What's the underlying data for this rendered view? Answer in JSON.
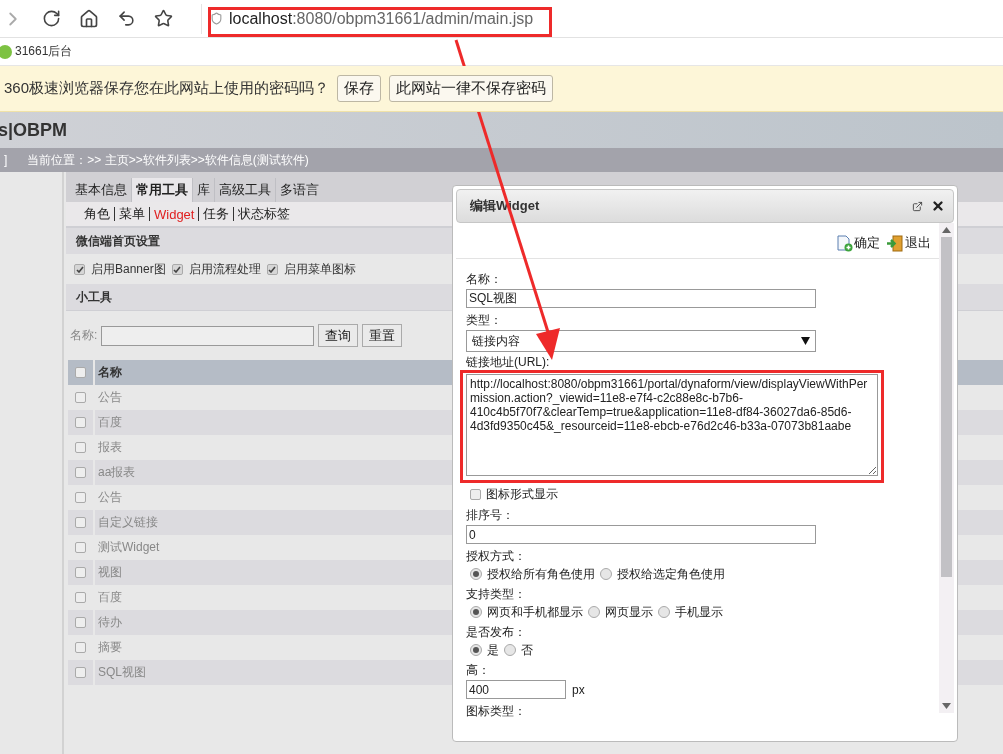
{
  "browser": {
    "address": {
      "host": "localhost",
      "rest": ":8080/obpm31661/admin/main.jsp"
    },
    "bookmark": "31661后台"
  },
  "password_prompt": {
    "message": "360极速浏览器保存您在此网站上使用的密码吗？",
    "buttons": [
      "保存",
      "此网站一律不保存密码"
    ]
  },
  "header": {
    "logo": "s|OBPM"
  },
  "breadcrumb": {
    "edit_link": "]",
    "location": "当前位置：>> 主页>>软件列表>>软件信息(测试软件)"
  },
  "tabs": [
    {
      "label": "基本信息",
      "selected": false
    },
    {
      "label": "常用工具",
      "selected": true
    },
    {
      "label": "库",
      "selected": false
    },
    {
      "label": "高级工具",
      "selected": false
    },
    {
      "label": "多语言",
      "selected": false
    }
  ],
  "subtabs": [
    {
      "label": "角色",
      "selected": false
    },
    {
      "label": "菜单",
      "selected": false
    },
    {
      "label": "Widget",
      "selected": true
    },
    {
      "label": "任务",
      "selected": false
    },
    {
      "label": "状态标签",
      "selected": false
    }
  ],
  "wechat_section": {
    "title": "微信端首页设置",
    "options": [
      {
        "label": "启用Banner图",
        "checked": true
      },
      {
        "label": "启用流程处理",
        "checked": true
      },
      {
        "label": "启用菜单图标",
        "checked": true
      }
    ]
  },
  "widgets_section": {
    "title": "小工具",
    "search_label": "名称:",
    "buttons": [
      "查询",
      "重置"
    ],
    "table": {
      "columns": [
        "名称"
      ],
      "select_all_checked": false,
      "rows": [
        {
          "name": "公告",
          "checked": false
        },
        {
          "name": "百度",
          "checked": false
        },
        {
          "name": "报表",
          "checked": false
        },
        {
          "name": "aa报表",
          "checked": false
        },
        {
          "name": "公告",
          "checked": false
        },
        {
          "name": "自定义链接",
          "checked": false
        },
        {
          "name": "测试Widget",
          "checked": false
        },
        {
          "name": "视图",
          "checked": false
        },
        {
          "name": "百度",
          "checked": false
        },
        {
          "name": "待办",
          "checked": false
        },
        {
          "name": "摘要",
          "checked": false
        },
        {
          "name": "SQL视图",
          "checked": false
        }
      ]
    }
  },
  "dialog": {
    "title": "编辑Widget",
    "actions": [
      {
        "kind": "confirm",
        "label": "确定"
      },
      {
        "kind": "exit",
        "label": "退出"
      }
    ],
    "fields": [
      {
        "kind": "text",
        "label": "名称：",
        "value": "SQL视图"
      },
      {
        "kind": "select",
        "label": "类型：",
        "value": "链接内容"
      },
      {
        "kind": "textarea",
        "label": "链接地址(URL):",
        "value": "http://localhost:8080/obpm31661/portal/dynaform/view/displayViewWithPermission.action?_viewid=11e8-e7f4-c2c88e8c-b7b6-410c4b5f70f7&clearTemp=true&application=11e8-df84-36027da6-85d6-4d3fd9350c45&_resourceid=11e8-ebcb-e76d2c46-b33a-07073b81aabe"
      },
      {
        "kind": "checkbox",
        "label": "图标形式显示",
        "checked": false
      },
      {
        "kind": "text",
        "label": "排序号：",
        "value": "0"
      },
      {
        "kind": "radio",
        "label": "授权方式：",
        "options": [
          {
            "label": "授权给所有角色使用",
            "selected": true
          },
          {
            "label": "授权给选定角色使用",
            "selected": false
          }
        ]
      },
      {
        "kind": "radio",
        "label": "支持类型：",
        "options": [
          {
            "label": "网页和手机都显示",
            "selected": true
          },
          {
            "label": "网页显示",
            "selected": false
          },
          {
            "label": "手机显示",
            "selected": false
          }
        ]
      },
      {
        "kind": "radio",
        "label": "是否发布：",
        "options": [
          {
            "label": "是",
            "selected": true
          },
          {
            "label": "否",
            "selected": false
          }
        ]
      },
      {
        "kind": "short",
        "label": "高：",
        "value": "400",
        "unit": "px"
      },
      {
        "kind": "heading",
        "label": "图标类型："
      }
    ]
  }
}
